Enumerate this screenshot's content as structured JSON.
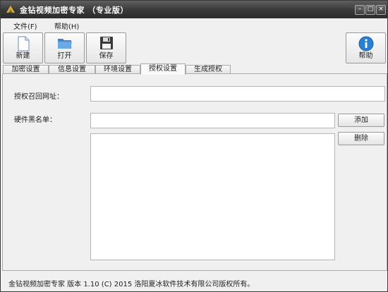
{
  "window": {
    "title": "金钻视频加密专家 （专业版）"
  },
  "window_controls": {
    "minimize": "–",
    "maximize": "□",
    "close": "×"
  },
  "menu": [
    {
      "label": "文件(F)"
    },
    {
      "label": "帮助(H)"
    }
  ],
  "toolbar": {
    "new_label": "新建",
    "open_label": "打开",
    "save_label": "保存",
    "help_label": "帮助"
  },
  "tabs": [
    {
      "label": "加密设置"
    },
    {
      "label": "信息设置"
    },
    {
      "label": "环境设置"
    },
    {
      "label": "授权设置",
      "active": true
    },
    {
      "label": "生成授权"
    }
  ],
  "form": {
    "callback_url_label": "授权召回网址：",
    "callback_url_value": "",
    "hardware_blacklist_label": "硬件黑名单：",
    "hardware_blacklist_value": "",
    "add_button": "添加",
    "delete_button": "删除",
    "blacklist_items": []
  },
  "status": {
    "text": "金钻视频加密专家  版本 1.10 (C)  2015 洛阳夏冰软件技术有限公司版权所有。"
  },
  "colors": {
    "titlebar": "#3b3b3b",
    "help_icon": "#2a7fd0",
    "folder_icon": "#5a9ad6"
  }
}
